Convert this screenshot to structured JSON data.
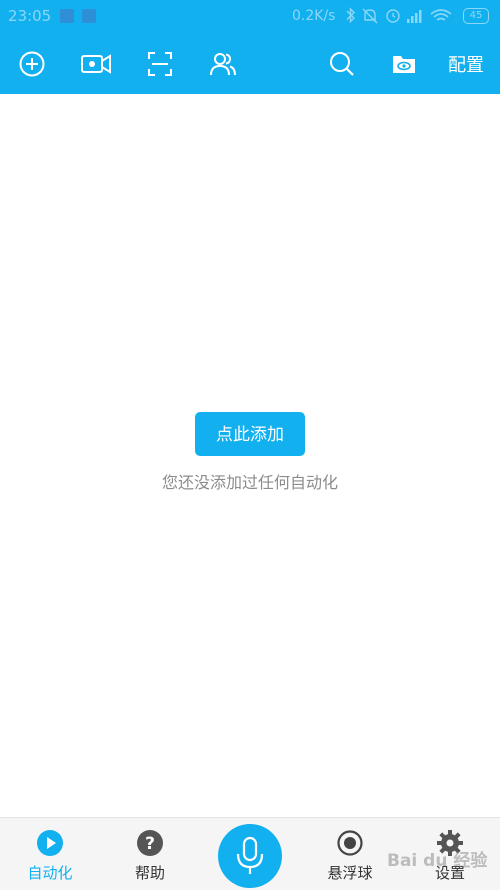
{
  "status_bar": {
    "time": "23:05",
    "speed": "0.2K/s",
    "battery": "45"
  },
  "toolbar": {
    "config_label": "配置"
  },
  "main": {
    "add_button_label": "点此添加",
    "empty_message": "您还没添加过任何自动化"
  },
  "bottom_nav": {
    "items": [
      {
        "label": "自动化",
        "icon": "play-circle-icon",
        "active": true
      },
      {
        "label": "帮助",
        "icon": "help-circle-icon",
        "active": false
      },
      {
        "label": "",
        "icon": "mic-icon",
        "active": false
      },
      {
        "label": "悬浮球",
        "icon": "floating-ball-icon",
        "active": false
      },
      {
        "label": "设置",
        "icon": "gear-icon",
        "active": false
      }
    ]
  },
  "watermark": "Bai du 经验",
  "colors": {
    "accent": "#12b0ef",
    "text_muted": "#8c8c8c",
    "nav_bg": "#f5f5f5"
  }
}
